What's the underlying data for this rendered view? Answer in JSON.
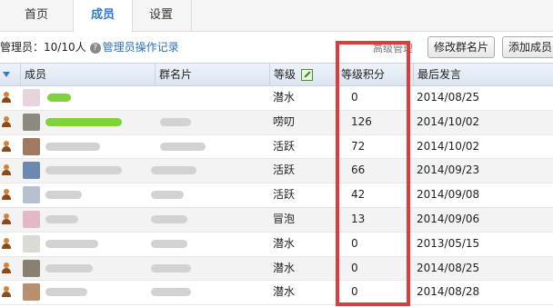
{
  "tabs": [
    {
      "label": "首页"
    },
    {
      "label": "成员"
    },
    {
      "label": "设置"
    }
  ],
  "toolbar": {
    "admin_text": "管理员：10/10人",
    "admin_log_link": "管理员操作记录",
    "advanced_text": "高级管理",
    "edit_card_button": "修改群名片",
    "add_member_button": "添加成员"
  },
  "table": {
    "headers": {
      "member": "成员",
      "card": "群名片",
      "level": "等级",
      "points": "等级积分",
      "last_post": "最后发言"
    },
    "rows": [
      {
        "level": "潜水",
        "points": "0",
        "last_post": "2014/08/25"
      },
      {
        "level": "唠叨",
        "points": "126",
        "last_post": "2014/10/02"
      },
      {
        "level": "活跃",
        "points": "72",
        "last_post": "2014/10/02"
      },
      {
        "level": "活跃",
        "points": "66",
        "last_post": "2014/09/23"
      },
      {
        "level": "活跃",
        "points": "42",
        "last_post": "2014/09/08"
      },
      {
        "level": "冒泡",
        "points": "13",
        "last_post": "2014/09/06"
      },
      {
        "level": "潜水",
        "points": "0",
        "last_post": "2013/05/15"
      },
      {
        "level": "潜水",
        "points": "0",
        "last_post": "2014/08/25"
      },
      {
        "level": "潜水",
        "points": "0",
        "last_post": "2014/08/28"
      }
    ]
  },
  "colors": {
    "highlight_box": "#e03a3a",
    "tab_active": "#2d7bd0",
    "link": "#2d6fb8"
  }
}
